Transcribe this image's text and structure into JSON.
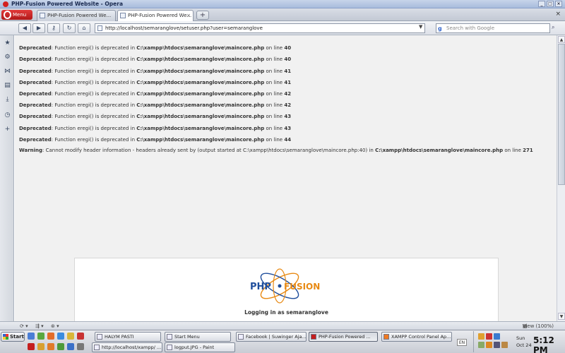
{
  "window": {
    "title": "PHP-Fusion Powered Website - Opera",
    "minimize": "_",
    "maximize": "□",
    "close": "×"
  },
  "tabs": {
    "menu_label": "Menu",
    "items": [
      {
        "label": "PHP-Fusion Powered We..."
      },
      {
        "label": "PHP-Fusion Powered We..."
      }
    ],
    "new_tab": "+"
  },
  "address": {
    "url": "http://localhost/semaranglove/setuser.php?user=semaranglove",
    "search_placeholder": "Search with Google",
    "search_engine_glyph": "g"
  },
  "errors": [
    {
      "type": "Deprecated",
      "msg": ": Function eregi() is deprecated in ",
      "path": "C:\\xampp\\htdocs\\semaranglove\\maincore.php",
      "online": " on line ",
      "line": "40"
    },
    {
      "type": "Deprecated",
      "msg": ": Function eregi() is deprecated in ",
      "path": "C:\\xampp\\htdocs\\semaranglove\\maincore.php",
      "online": " on line ",
      "line": "40"
    },
    {
      "type": "Deprecated",
      "msg": ": Function eregi() is deprecated in ",
      "path": "C:\\xampp\\htdocs\\semaranglove\\maincore.php",
      "online": " on line ",
      "line": "41"
    },
    {
      "type": "Deprecated",
      "msg": ": Function eregi() is deprecated in ",
      "path": "C:\\xampp\\htdocs\\semaranglove\\maincore.php",
      "online": " on line ",
      "line": "41"
    },
    {
      "type": "Deprecated",
      "msg": ": Function eregi() is deprecated in ",
      "path": "C:\\xampp\\htdocs\\semaranglove\\maincore.php",
      "online": " on line ",
      "line": "42"
    },
    {
      "type": "Deprecated",
      "msg": ": Function eregi() is deprecated in ",
      "path": "C:\\xampp\\htdocs\\semaranglove\\maincore.php",
      "online": " on line ",
      "line": "42"
    },
    {
      "type": "Deprecated",
      "msg": ": Function eregi() is deprecated in ",
      "path": "C:\\xampp\\htdocs\\semaranglove\\maincore.php",
      "online": " on line ",
      "line": "43"
    },
    {
      "type": "Deprecated",
      "msg": ": Function eregi() is deprecated in ",
      "path": "C:\\xampp\\htdocs\\semaranglove\\maincore.php",
      "online": " on line ",
      "line": "43"
    },
    {
      "type": "Deprecated",
      "msg": ": Function eregi() is deprecated in ",
      "path": "C:\\xampp\\htdocs\\semaranglove\\maincore.php",
      "online": " on line ",
      "line": "44"
    }
  ],
  "warning": {
    "type": "Warning",
    "msg": ": Cannot modify header information - headers already sent by (output started at C:\\xampp\\htdocs\\semaranglove\\maincore.php:40) in ",
    "path": "C:\\xampp\\htdocs\\semaranglove\\maincore.php",
    "online": " on line ",
    "line": "271"
  },
  "login": {
    "logo_left": "PHP",
    "logo_right": "FUSION",
    "message": "Logging in as semaranglove"
  },
  "statusbar": {
    "view": "View (100%)"
  },
  "taskbar": {
    "start": "Start",
    "tasks_row1": [
      {
        "label": "HALYM PASTI"
      },
      {
        "label": "Start Menu"
      },
      {
        "label": "Facebook | Suwinger Aja..."
      },
      {
        "label": "PHP-Fusion Powered ..."
      },
      {
        "label": "XAMPP Control Panel Ap..."
      }
    ],
    "tasks_row2": [
      {
        "label": "http://localhost/xampp/ ..."
      },
      {
        "label": "logput.JPG - Paint"
      }
    ],
    "lang": "EN",
    "clock_day": "Sun",
    "clock_date": "Oct 24",
    "clock_time": "5:12 PM"
  },
  "colors": {
    "opera_red": "#c41e1e",
    "logo_blue": "#1f4e9c",
    "logo_orange": "#e88a14"
  }
}
